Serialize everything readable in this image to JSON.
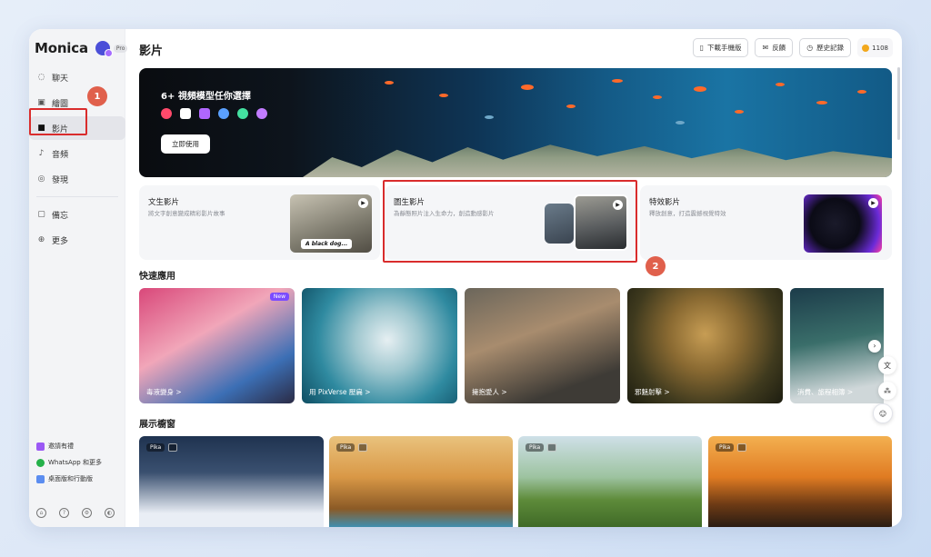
{
  "sidebar": {
    "brand": "Monica",
    "brand_badge": "Pro",
    "items": [
      {
        "label": "聊天",
        "icon": "chat-icon",
        "glyph": "◌"
      },
      {
        "label": "繪圖",
        "icon": "image-icon",
        "glyph": "▣"
      },
      {
        "label": "影片",
        "icon": "video-icon",
        "glyph": "■"
      },
      {
        "label": "音頻",
        "icon": "audio-icon",
        "glyph": "♪"
      },
      {
        "label": "發現",
        "icon": "compass-icon",
        "glyph": "◎"
      }
    ],
    "items2": [
      {
        "label": "備忘",
        "icon": "memo-icon",
        "glyph": "▢"
      },
      {
        "label": "更多",
        "icon": "plus-circle-icon",
        "glyph": "⊕"
      }
    ],
    "bottom_links": [
      {
        "label": "邀請有禮",
        "color": "#9b59f5"
      },
      {
        "label": "WhatsApp 和更多",
        "color": "#25b14a"
      },
      {
        "label": "桌面版和行動版",
        "color": "#5b8df0"
      }
    ],
    "bottom_icons": [
      "home-icon",
      "help-icon",
      "settings-icon",
      "theme-icon"
    ]
  },
  "annotations": {
    "one": "1",
    "two": "2"
  },
  "header": {
    "title": "影片",
    "download": "下載手機版",
    "feedback": "反饋",
    "history": "歷史記錄",
    "credits": "1108"
  },
  "hero": {
    "title": "6+ 視頻模型任你選擇",
    "button": "立即使用",
    "logo_colors": [
      "#ff4a6b",
      "#ffffff",
      "#b067ff",
      "#5aa0ff",
      "#44e0a0",
      "#c27cff"
    ]
  },
  "cards": [
    {
      "title": "文生影片",
      "desc": "將文字創意變成精彩影片故事",
      "caption": "A black dog..."
    },
    {
      "title": "圖生影片",
      "desc": "為靜態照片注入生命力，創造動感影片"
    },
    {
      "title": "特效影片",
      "desc": "釋放創意，打造震撼視覺特效"
    }
  ],
  "quick": {
    "title": "快速應用",
    "items": [
      {
        "label": "毒液變身 >",
        "badge": "New"
      },
      {
        "label": "用 PixVerse 壓扁 >"
      },
      {
        "label": "擁抱愛人 >"
      },
      {
        "label": "邪魅射擊 >"
      },
      {
        "label": "消費、旅程相簿 >"
      }
    ]
  },
  "showcase": {
    "title": "展示櫥窗",
    "tag": "Pika",
    "count": 4
  }
}
